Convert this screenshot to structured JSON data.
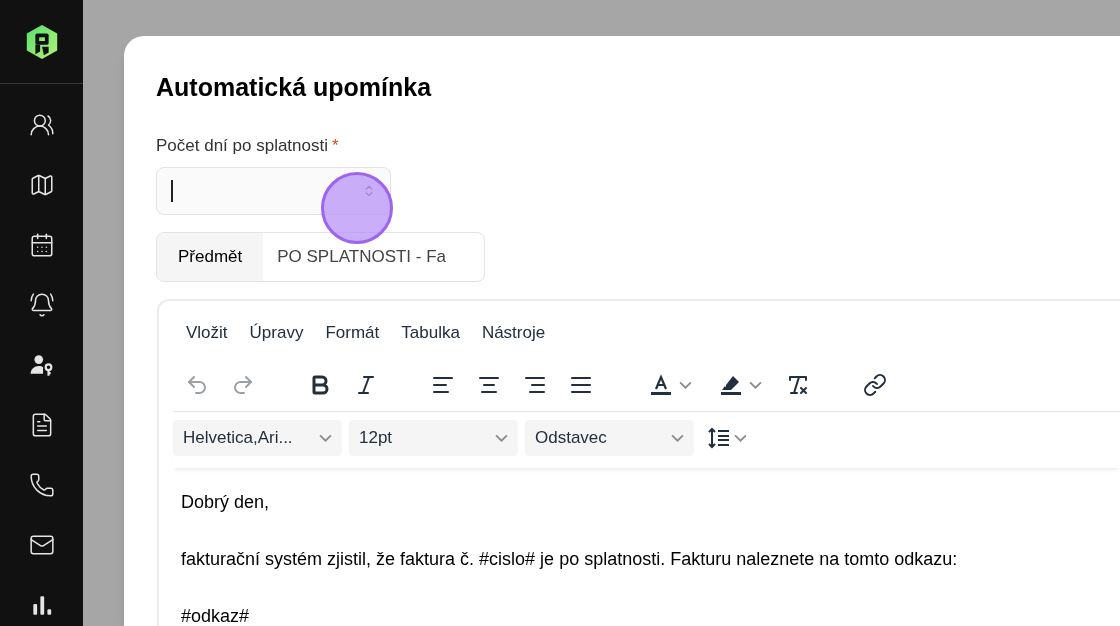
{
  "sidebar": {
    "items": [
      {
        "kind": "users"
      },
      {
        "kind": "map"
      },
      {
        "kind": "calendar"
      },
      {
        "kind": "alarm"
      },
      {
        "kind": "user-key"
      },
      {
        "kind": "document"
      },
      {
        "kind": "phone"
      },
      {
        "kind": "mail"
      },
      {
        "kind": "chart"
      }
    ]
  },
  "dialog": {
    "title": "Automatická upomínka",
    "days_field": {
      "label": "Počet dní po splatnosti",
      "required_mark": "*"
    },
    "subject": {
      "label": "Předmět",
      "value": "PO SPLATNOSTI - Fa"
    },
    "editor": {
      "menu": [
        "Vložit",
        "Úpravy",
        "Formát",
        "Tabulka",
        "Nástroje"
      ],
      "toolbar_groups": [
        {
          "buttons": [
            {
              "kind": "undo",
              "disabled": true
            },
            {
              "kind": "redo",
              "disabled": true
            }
          ]
        },
        {
          "buttons": [
            {
              "kind": "bold",
              "disabled": false
            },
            {
              "kind": "italic",
              "disabled": false
            }
          ]
        },
        {
          "buttons": [
            {
              "kind": "align-left",
              "disabled": false
            },
            {
              "kind": "align-center",
              "disabled": false
            },
            {
              "kind": "align-right",
              "disabled": false
            },
            {
              "kind": "align-justify",
              "disabled": false
            }
          ]
        },
        {
          "buttons": [
            {
              "kind": "text-color",
              "disabled": false
            },
            {
              "kind": "highlight",
              "disabled": false
            },
            {
              "kind": "clear-format",
              "disabled": false
            }
          ]
        },
        {
          "buttons": [
            {
              "kind": "link",
              "disabled": false
            }
          ]
        }
      ],
      "selects": [
        {
          "value": "Helvetica,Ari..."
        },
        {
          "value": "12pt"
        },
        {
          "value": "Odstavec"
        }
      ],
      "body": [
        "Dobrý den,",
        "fakturační systém zjistil, že faktura č. #cislo# je po splatnosti. Fakturu naleznete na tomto odkazu:",
        "#odkaz#"
      ]
    }
  }
}
